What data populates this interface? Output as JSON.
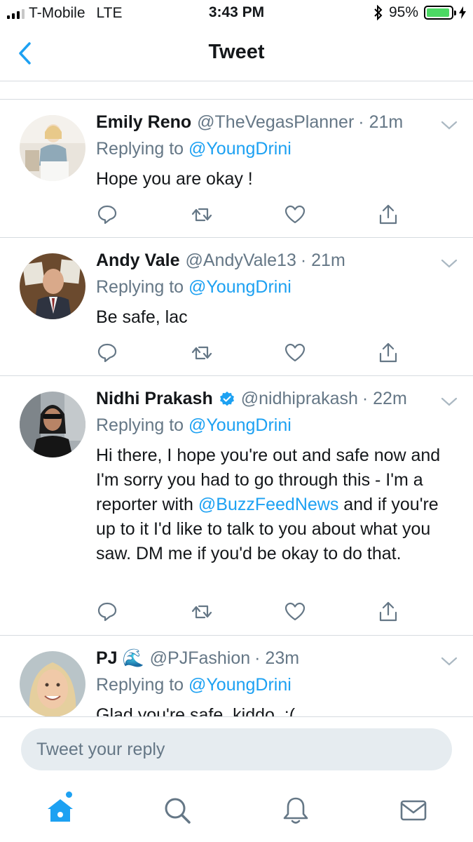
{
  "status_bar": {
    "carrier": "T-Mobile",
    "network": "LTE",
    "time": "3:43 PM",
    "battery": "95%",
    "battery_level": 0.95,
    "bluetooth_icon": "bluetooth-icon",
    "charging_icon": "bolt-icon"
  },
  "nav": {
    "title": "Tweet",
    "back_icon": "chevron-left-icon"
  },
  "colors": {
    "accent": "#1da1f2",
    "secondary_text": "#657786",
    "divider": "#d6dbe0",
    "input_bg": "#e6ecf0"
  },
  "replies": [
    {
      "name": "Emily Reno",
      "handle": "@TheVegasPlanner",
      "time": "· 21m",
      "replying_prefix": "Replying to",
      "replying_to": "@YoungDrini",
      "text_before": "Hope you are okay !",
      "text_mention": "",
      "text_after": ""
    },
    {
      "name": "Andy Vale",
      "handle": "@AndyVale13",
      "time": "· 21m",
      "replying_prefix": "Replying to",
      "replying_to": "@YoungDrini",
      "text_before": "Be safe, lac",
      "text_mention": "",
      "text_after": ""
    },
    {
      "name": "Nidhi Prakash",
      "verified": true,
      "handle": "@nidhiprakash",
      "time": "· 22m",
      "replying_prefix": "Replying to",
      "replying_to": "@YoungDrini",
      "text_before": "Hi there, I hope you're out and safe now and I'm sorry you had to go through this - I'm a reporter with ",
      "text_mention": "@BuzzFeedNews",
      "text_after": " and if you're up to it I'd like to talk to you about what you saw. DM me if you'd be okay to do that."
    },
    {
      "name": "PJ 🌊",
      "handle": "@PJFashion",
      "time": "· 23m",
      "replying_prefix": "Replying to",
      "replying_to": "@YoungDrini",
      "text_before": "Glad you're safe, kiddo. :(",
      "text_mention": "",
      "text_after": ""
    }
  ],
  "action_icons": [
    "reply-icon",
    "retweet-icon",
    "like-icon",
    "share-icon"
  ],
  "composer": {
    "placeholder": "Tweet your reply"
  },
  "tab_bar": {
    "items": [
      "home-icon",
      "search-icon",
      "notifications-icon",
      "messages-icon"
    ],
    "active": "home-icon"
  }
}
